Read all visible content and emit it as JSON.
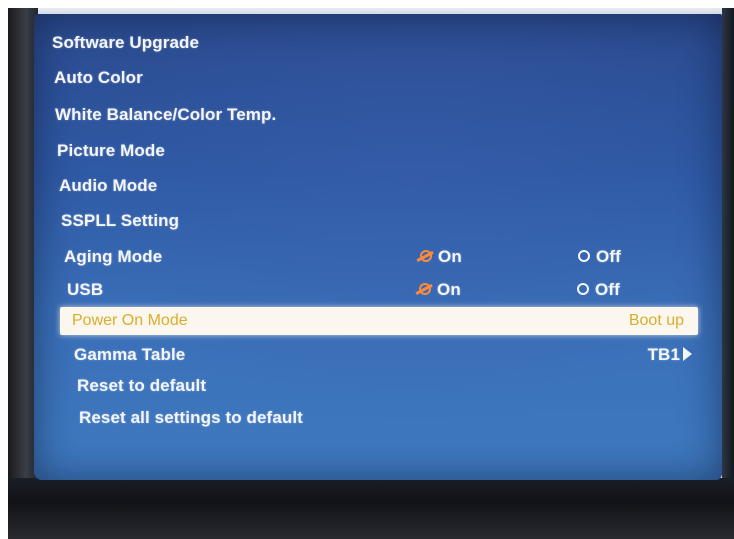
{
  "menu": {
    "items": [
      {
        "label": "Software Upgrade"
      },
      {
        "label": "Auto Color"
      },
      {
        "label": "White Balance/Color Temp."
      },
      {
        "label": "Picture Mode"
      },
      {
        "label": "Audio Mode"
      },
      {
        "label": "SSPLL Setting"
      },
      {
        "label": "Aging Mode",
        "on_label": "On",
        "off_label": "Off",
        "selected": "On"
      },
      {
        "label": "USB",
        "on_label": "On",
        "off_label": "Off",
        "selected": "On"
      },
      {
        "label": "Power On Mode",
        "value": "Boot up",
        "highlighted": true
      },
      {
        "label": "Gamma Table",
        "value": "TB1"
      },
      {
        "label": "Reset to default"
      },
      {
        "label": "Reset all settings to default"
      }
    ]
  },
  "colors": {
    "screen_blue": "#2f5aa5",
    "text_white": "#f4f6fb",
    "highlight_bar": "#fbf7ee",
    "highlight_text": "#d8ae2c",
    "radio_checked": "#ff8a3a"
  },
  "icons": {
    "radio_checked": "radio-checked-icon",
    "radio_unchecked": "radio-unchecked-icon",
    "submenu_arrow": "arrow-right-icon"
  }
}
